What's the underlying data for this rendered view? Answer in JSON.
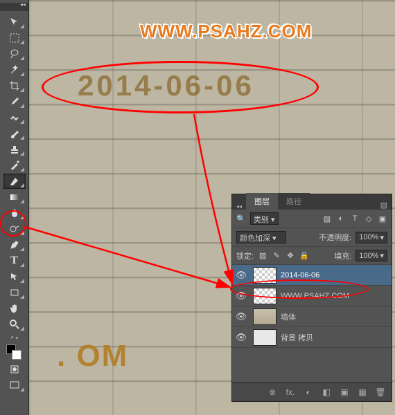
{
  "canvas": {
    "watermark": "WWW.PSAHZ.COM",
    "date_text": "2014-06-06",
    "corner_text": ". OM"
  },
  "tools": {
    "move": "↖",
    "marquee": "⬚",
    "lasso": "◯",
    "wand": "✦",
    "crop": "✂",
    "eyedrop": "✎",
    "heal": "✚",
    "brush": "／",
    "stamp": "⎍",
    "history": "↺",
    "eraser": "◧",
    "gradient": "▤",
    "blur": "💧",
    "dodge": "○",
    "pen": "✒",
    "type": "T",
    "path": "↗",
    "rect": "▭",
    "hand": "✋",
    "zoom": "🔍",
    "swap": "⇄",
    "fg": "■",
    "bg": "□",
    "mode": "▣"
  },
  "panel": {
    "tabs": {
      "layers": "图层",
      "paths": "路径"
    },
    "filter_label": "类别",
    "blend_mode": "颜色加深",
    "opacity_label": "不透明度:",
    "opacity_value": "100%",
    "lock_label": "锁定:",
    "fill_label": "填充:",
    "fill_value": "100%"
  },
  "layers": [
    {
      "name": "2014-06-06",
      "thumb": "checker",
      "selected": true
    },
    {
      "name": "WWW.PSAHZ.COM",
      "thumb": "checker",
      "selected": false
    },
    {
      "name": "墙体",
      "thumb": "wall",
      "selected": false
    },
    {
      "name": "背景 拷贝",
      "thumb": "bg",
      "selected": false
    }
  ],
  "footer_icons": [
    "⊗",
    "fx.",
    "◐",
    "◧",
    "▣",
    "▦",
    "🗑"
  ]
}
